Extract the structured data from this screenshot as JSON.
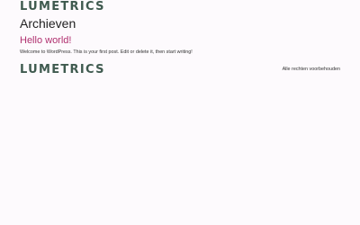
{
  "colors": {
    "background": "#fdfafd",
    "brand": "#3f5a4f",
    "post_title": "#b0306f",
    "text": "#222222"
  },
  "header": {
    "logo_text": "LUMETRICS"
  },
  "main": {
    "archive_title": "Archieven",
    "posts": [
      {
        "title": "Hello world!",
        "excerpt": "Welcome to WordPress. This is your first post. Edit or delete it, then start writing!"
      }
    ]
  },
  "footer": {
    "logo_text": "LUMETRICS",
    "copyright": "Alle rechten voorbehouden"
  }
}
